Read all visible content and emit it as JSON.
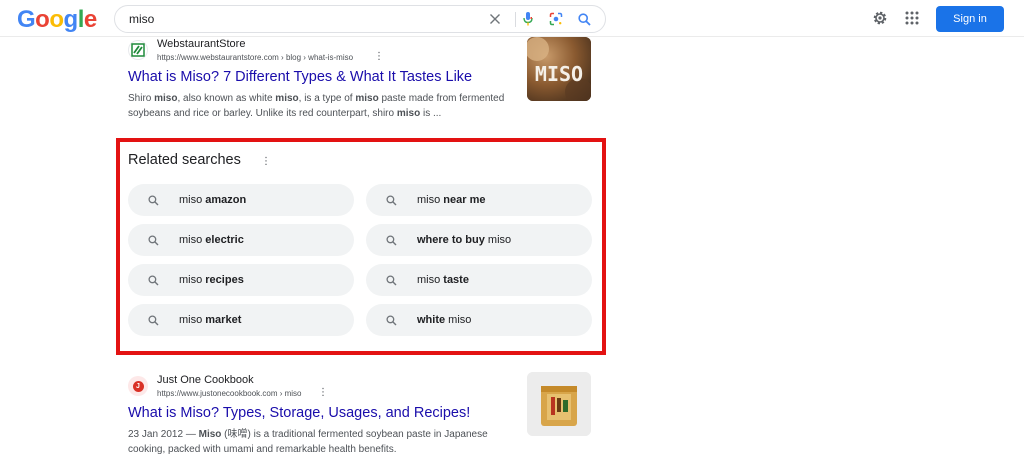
{
  "header": {
    "logo_letters": [
      {
        "ch": "G",
        "color": "#4285F4"
      },
      {
        "ch": "o",
        "color": "#EA4335"
      },
      {
        "ch": "o",
        "color": "#FBBC05"
      },
      {
        "ch": "g",
        "color": "#4285F4"
      },
      {
        "ch": "l",
        "color": "#34A853"
      },
      {
        "ch": "e",
        "color": "#EA4335"
      }
    ],
    "search_value": "miso",
    "icons": {
      "clear": "close-icon",
      "mic": "microphone-icon",
      "lens": "google-lens-icon",
      "search": "search-icon",
      "settings": "gear-icon",
      "apps": "apps-grid-icon"
    },
    "signin_label": "Sign in",
    "accent_color": "#1a73e8"
  },
  "results": [
    {
      "site_name": "WebstaurantStore",
      "url": "https://www.webstaurantstore.com › blog › what-is-miso",
      "title": "What is Miso? 7 Different Types & What It Tastes Like",
      "snippet_parts": [
        {
          "t": "Shiro ",
          "b": false
        },
        {
          "t": "miso",
          "b": true
        },
        {
          "t": ", also known as white ",
          "b": false
        },
        {
          "t": "miso",
          "b": true
        },
        {
          "t": ", is a type of ",
          "b": false
        },
        {
          "t": "miso",
          "b": true
        },
        {
          "t": " paste made from fermented soybeans and rice or barley. Unlike its red counterpart, shiro ",
          "b": false
        },
        {
          "t": "miso",
          "b": true
        },
        {
          "t": " is ...",
          "b": false
        }
      ],
      "thumb_text": "MISO"
    },
    {
      "site_name": "Just One Cookbook",
      "url": "https://www.justonecookbook.com › miso",
      "title": "What is Miso? Types, Storage, Usages, and Recipes!",
      "snippet_parts": [
        {
          "t": "23 Jan 2012 — ",
          "b": false
        },
        {
          "t": "Miso",
          "b": true
        },
        {
          "t": " (味噌) is a traditional fermented soybean paste in Japanese cooking, packed with umami and remarkable health benefits.",
          "b": false
        }
      ],
      "favicon_letter": "J"
    }
  ],
  "related": {
    "title": "Related searches",
    "highlight_color": "#e31212",
    "chips": [
      [
        {
          "t": "miso ",
          "b": false
        },
        {
          "t": "amazon",
          "b": true
        }
      ],
      [
        {
          "t": "miso ",
          "b": false
        },
        {
          "t": "near me",
          "b": true
        }
      ],
      [
        {
          "t": "miso ",
          "b": false
        },
        {
          "t": "electric",
          "b": true
        }
      ],
      [
        {
          "t": "where to buy",
          "b": true
        },
        {
          "t": " miso",
          "b": false
        }
      ],
      [
        {
          "t": "miso ",
          "b": false
        },
        {
          "t": "recipes",
          "b": true
        }
      ],
      [
        {
          "t": "miso ",
          "b": false
        },
        {
          "t": "taste",
          "b": true
        }
      ],
      [
        {
          "t": "miso ",
          "b": false
        },
        {
          "t": "market",
          "b": true
        }
      ],
      [
        {
          "t": "white",
          "b": true
        },
        {
          "t": " miso",
          "b": false
        }
      ]
    ]
  }
}
